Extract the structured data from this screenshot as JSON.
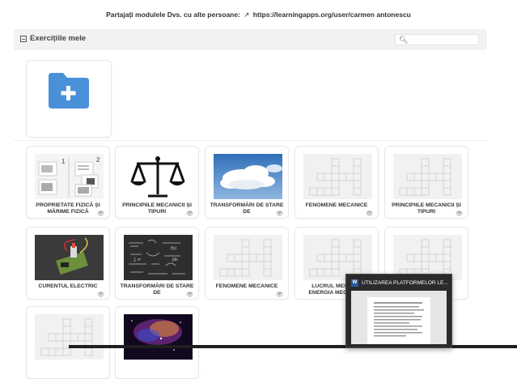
{
  "share": {
    "text": "Partajați modulele Dvs. cu alte persoane:",
    "icon": "external-link-icon",
    "link": "https://learningapps.org/user/carmen antonescu"
  },
  "section": {
    "title": "Exercițiile mele",
    "search_placeholder": ""
  },
  "new_app": {
    "icon": "folder-add-icon",
    "color": "#4a90d9"
  },
  "apps": [
    {
      "title": "PROPRIETATE FIZICĂ ȘI MĂRIME FIZICĂ",
      "thumb": "cards"
    },
    {
      "title": "PRINCIPIILE MECANICII ȘI TIPURI",
      "thumb": "scale"
    },
    {
      "title": "TRANSFORMĂRI DE STARE DE",
      "thumb": "sky"
    },
    {
      "title": "FENOMENE MECANICE",
      "thumb": "crossword"
    },
    {
      "title": "PRINCIPIILE MECANICII ȘI TIPURI",
      "thumb": "crossword"
    },
    {
      "title": "CURENTUL ELECTRIC",
      "thumb": "circuit"
    },
    {
      "title": "TRANSFORMĂRI DE STARE DE",
      "thumb": "chalk"
    },
    {
      "title": "FENOMENE MECANICE",
      "thumb": "crossword"
    },
    {
      "title": "LUCRUL MECANIC ENERGIA MECANICĂ",
      "thumb": "crossword"
    },
    {
      "title": "",
      "thumb": "crossword"
    },
    {
      "title": "",
      "thumb": "crossword"
    },
    {
      "title": "",
      "thumb": "space"
    }
  ],
  "taskbar_preview": {
    "title": "UTILIZAREA PLATFORMELOR LE...",
    "app_icon": "word-icon"
  }
}
